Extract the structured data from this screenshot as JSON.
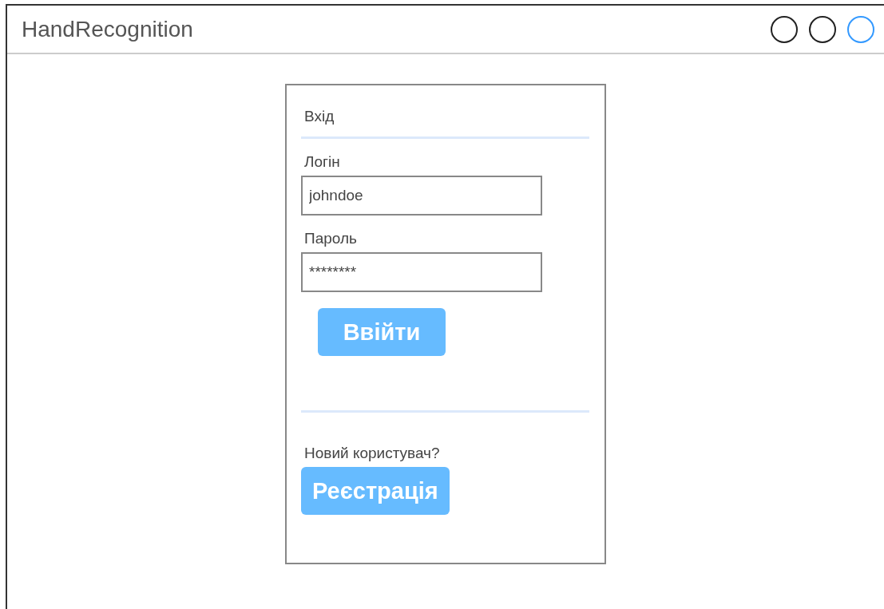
{
  "window": {
    "title": "HandRecognition",
    "controls": [
      {
        "color": "#222222"
      },
      {
        "color": "#222222"
      },
      {
        "color": "#3399ff"
      }
    ]
  },
  "login": {
    "heading": "Вхід",
    "fields": [
      {
        "label": "Логін",
        "value": "johndoe"
      },
      {
        "label": "Пароль",
        "value": "********"
      }
    ],
    "submit": "Ввійти",
    "signup_prompt": "Новий користувач?",
    "signup_button": "Реєстрація"
  }
}
